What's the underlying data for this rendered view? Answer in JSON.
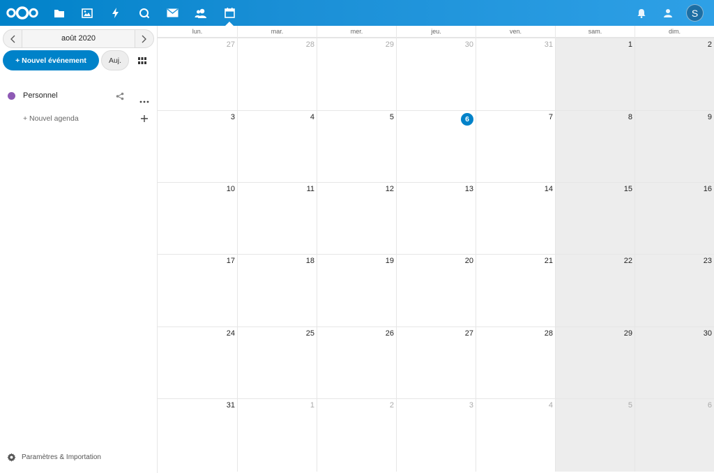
{
  "header": {
    "apps": [
      {
        "name": "files-icon",
        "active": false
      },
      {
        "name": "photos-icon",
        "active": false
      },
      {
        "name": "activity-icon",
        "active": false
      },
      {
        "name": "search-icon",
        "active": false
      },
      {
        "name": "mail-icon",
        "active": false
      },
      {
        "name": "contacts-icon",
        "active": false
      },
      {
        "name": "calendar-icon",
        "active": true
      }
    ],
    "avatar_initial": "S"
  },
  "sidebar": {
    "date_label": "août 2020",
    "new_event_label": "+ Nouvel événement",
    "today_label": "Auj.",
    "calendars": [
      {
        "name": "Personnel",
        "color": "#8e5ab5"
      }
    ],
    "new_calendar_label": "+ Nouvel agenda",
    "settings_label": "Paramètres & Importation"
  },
  "calendar": {
    "weekdays": [
      "lun.",
      "mar.",
      "mer.",
      "jeu.",
      "ven.",
      "sam.",
      "dim."
    ],
    "today": 6,
    "weeks": [
      [
        {
          "d": "27",
          "o": true
        },
        {
          "d": "28",
          "o": true
        },
        {
          "d": "29",
          "o": true
        },
        {
          "d": "30",
          "o": true
        },
        {
          "d": "31",
          "o": true
        },
        {
          "d": "1",
          "o": false
        },
        {
          "d": "2",
          "o": false
        }
      ],
      [
        {
          "d": "3",
          "o": false
        },
        {
          "d": "4",
          "o": false
        },
        {
          "d": "5",
          "o": false
        },
        {
          "d": "6",
          "o": false
        },
        {
          "d": "7",
          "o": false
        },
        {
          "d": "8",
          "o": false
        },
        {
          "d": "9",
          "o": false
        }
      ],
      [
        {
          "d": "10",
          "o": false
        },
        {
          "d": "11",
          "o": false
        },
        {
          "d": "12",
          "o": false
        },
        {
          "d": "13",
          "o": false
        },
        {
          "d": "14",
          "o": false
        },
        {
          "d": "15",
          "o": false
        },
        {
          "d": "16",
          "o": false
        }
      ],
      [
        {
          "d": "17",
          "o": false
        },
        {
          "d": "18",
          "o": false
        },
        {
          "d": "19",
          "o": false
        },
        {
          "d": "20",
          "o": false
        },
        {
          "d": "21",
          "o": false
        },
        {
          "d": "22",
          "o": false
        },
        {
          "d": "23",
          "o": false
        }
      ],
      [
        {
          "d": "24",
          "o": false
        },
        {
          "d": "25",
          "o": false
        },
        {
          "d": "26",
          "o": false
        },
        {
          "d": "27",
          "o": false
        },
        {
          "d": "28",
          "o": false
        },
        {
          "d": "29",
          "o": false
        },
        {
          "d": "30",
          "o": false
        }
      ],
      [
        {
          "d": "31",
          "o": false
        },
        {
          "d": "1",
          "o": true
        },
        {
          "d": "2",
          "o": true
        },
        {
          "d": "3",
          "o": true
        },
        {
          "d": "4",
          "o": true
        },
        {
          "d": "5",
          "o": true
        },
        {
          "d": "6",
          "o": true
        }
      ]
    ]
  },
  "colors": {
    "primary": "#0082c9",
    "weekend_bg": "#ededed"
  }
}
